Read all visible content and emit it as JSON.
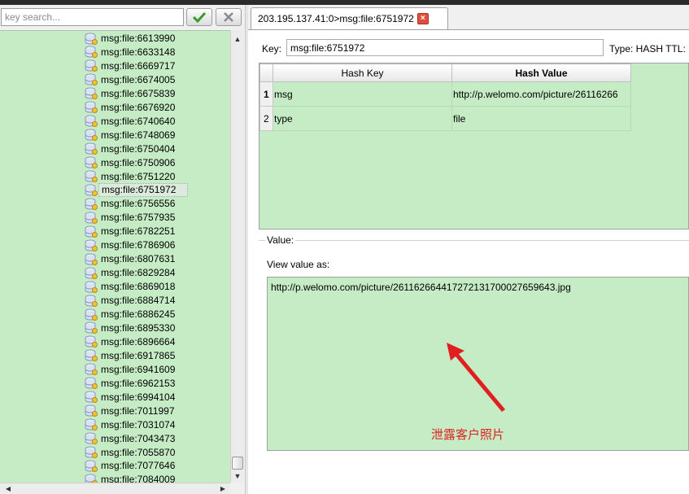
{
  "search": {
    "placeholder": "key search..."
  },
  "keys": [
    "msg:file:6613990",
    "msg:file:6633148",
    "msg:file:6669717",
    "msg:file:6674005",
    "msg:file:6675839",
    "msg:file:6676920",
    "msg:file:6740640",
    "msg:file:6748069",
    "msg:file:6750404",
    "msg:file:6750906",
    "msg:file:6751220",
    "msg:file:6751972",
    "msg:file:6756556",
    "msg:file:6757935",
    "msg:file:6782251",
    "msg:file:6786906",
    "msg:file:6807631",
    "msg:file:6829284",
    "msg:file:6869018",
    "msg:file:6884714",
    "msg:file:6886245",
    "msg:file:6895330",
    "msg:file:6896664",
    "msg:file:6917865",
    "msg:file:6941609",
    "msg:file:6962153",
    "msg:file:6994104",
    "msg:file:7011997",
    "msg:file:7031074",
    "msg:file:7043473",
    "msg:file:7055870",
    "msg:file:7077646",
    "msg:file:7084009"
  ],
  "selected_key": "msg:file:6751972",
  "tab": {
    "title": "203.195.137.41:0>msg:file:6751972",
    "close_glyph": "×"
  },
  "key_field": {
    "label": "Key:",
    "value": "msg:file:6751972"
  },
  "type_info": "Type: HASH  TTL:",
  "hash_table": {
    "headers": {
      "key": "Hash Key",
      "value": "Hash Value"
    },
    "rows": [
      {
        "num": "1",
        "key": "msg",
        "value": "http://p.welomo.com/picture/26116266"
      },
      {
        "num": "2",
        "key": "type",
        "value": "file"
      }
    ]
  },
  "value_section": {
    "title": "Value:",
    "view_as_label": "View value as:",
    "value_text": "http://p.welomo.com/picture/261162664417272131700027659643.jpg"
  },
  "annotation": {
    "text": "泄露客户照片",
    "color": "#e02020"
  },
  "colors": {
    "accent_green": "#c6ecc6",
    "annotation_red": "#e02020"
  }
}
